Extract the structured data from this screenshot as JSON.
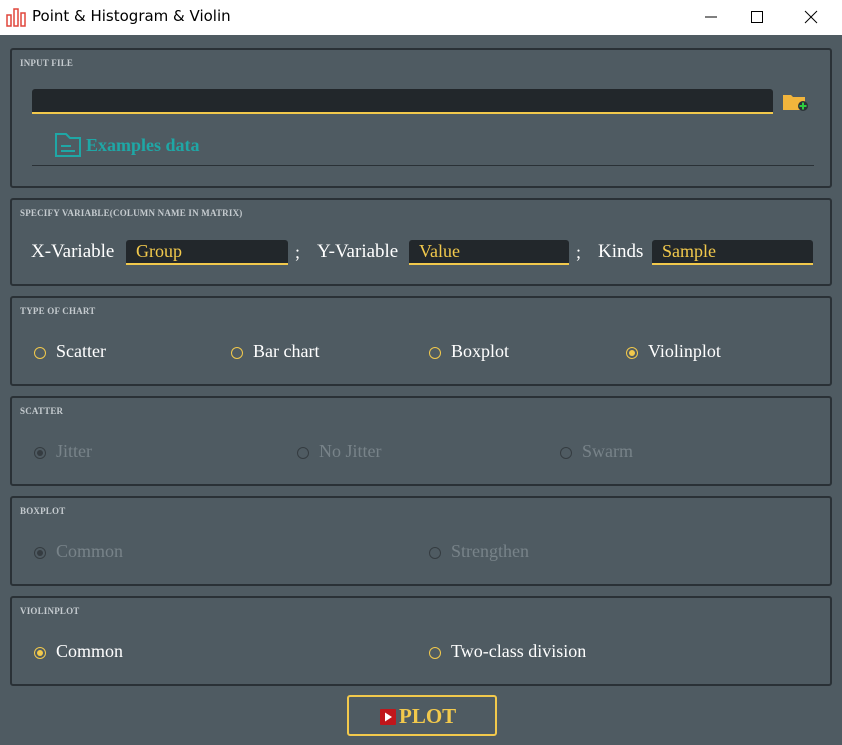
{
  "window": {
    "title": "Point & Histogram & Violin"
  },
  "colors": {
    "accent": "#f2c94c",
    "teal": "#1fa7a6",
    "background": "#4f5b62",
    "input_bg": "#22272b"
  },
  "input_file": {
    "label": "INPUT FILE",
    "value": "",
    "examples_label": "Examples data",
    "browse_icon": "folder-add-icon"
  },
  "variables": {
    "label": "SPECIFY VARIABLE(COLUMN NAME IN MATRIX)",
    "x_label": "X-Variable",
    "x_value": "Group",
    "y_label": "Y-Variable",
    "y_value": "Value",
    "kinds_label": "Kinds",
    "kinds_value": "Sample",
    "separator": ";"
  },
  "chart_type": {
    "label": "TYPE OF CHART",
    "options": [
      "Scatter",
      "Bar chart",
      "Boxplot",
      "Violinplot"
    ],
    "selected": "Violinplot"
  },
  "scatter": {
    "label": "SCATTER",
    "options": [
      "Jitter",
      "No Jitter",
      "Swarm"
    ],
    "selected": "Jitter",
    "enabled": false
  },
  "boxplot": {
    "label": "BOXPLOT",
    "options": [
      "Common",
      "Strengthen"
    ],
    "selected": "Common",
    "enabled": false
  },
  "violinplot": {
    "label": "VIOLINPLOT",
    "options": [
      "Common",
      "Two-class division"
    ],
    "selected": "Common",
    "enabled": true
  },
  "plot_button": {
    "label": "PLOT"
  }
}
